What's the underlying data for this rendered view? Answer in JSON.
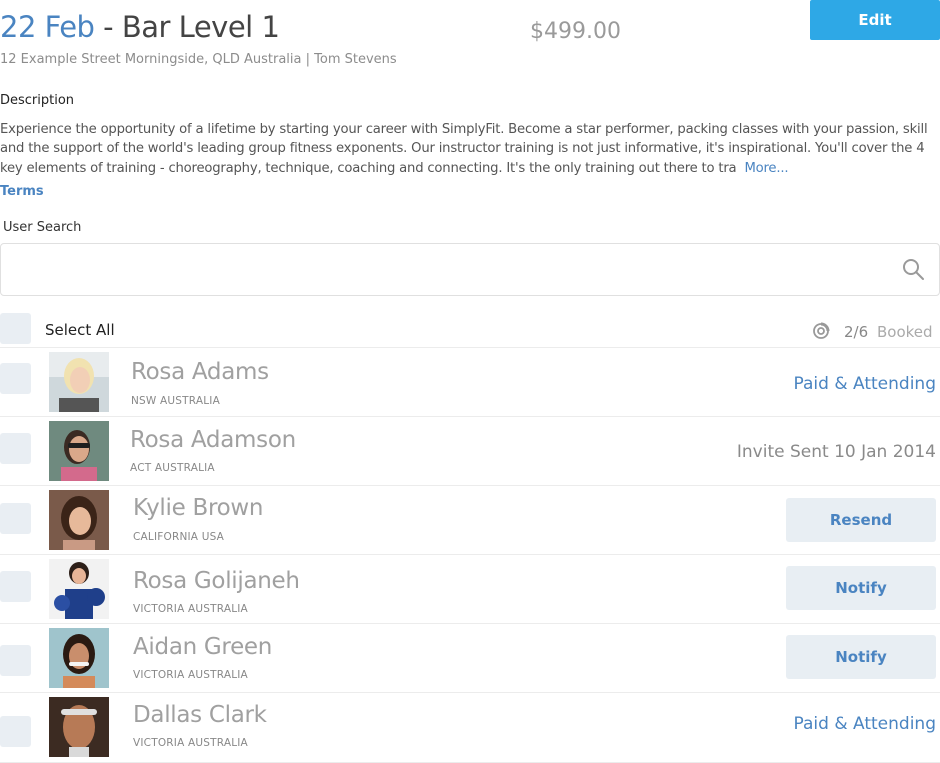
{
  "header": {
    "date": "22 Feb",
    "title_rest": " - Bar Level 1",
    "price": "$499.00",
    "edit_label": "Edit",
    "subtitle": "12 Example Street Morningside, QLD Australia | Tom Stevens"
  },
  "description": {
    "label": "Description",
    "text": "Experience the opportunity of a lifetime by starting your career with SimplyFit. Become a star performer, packing classes with your passion, skill and the support of the world's leading group fitness exponents.  Our instructor training is not just informative, it's inspirational. You'll cover the 4 key elements of training - choreography, technique, coaching and connecting. It's the only training out there to tra",
    "more_label": "More...",
    "terms_label": "Terms"
  },
  "search": {
    "label": "User Search",
    "value": "",
    "placeholder": ""
  },
  "list": {
    "select_all_label": "Select All",
    "booked_count": "2/6",
    "booked_label": "Booked",
    "users": [
      {
        "name": "Rosa Adams",
        "location": "NSW AUSTRALIA",
        "status": "Paid & Attending",
        "status_type": "paid"
      },
      {
        "name": "Rosa Adamson",
        "location": "ACT AUSTRALIA",
        "status": "Invite Sent 10 Jan 2014",
        "status_type": "invite"
      },
      {
        "name": "Kylie Brown",
        "location": "CALIFORNIA USA",
        "status": "Resend",
        "status_type": "button"
      },
      {
        "name": "Rosa Golijaneh",
        "location": "VICTORIA AUSTRALIA",
        "status": "Notify",
        "status_type": "button"
      },
      {
        "name": "Aidan Green",
        "location": "VICTORIA AUSTRALIA",
        "status": "Notify",
        "status_type": "button"
      },
      {
        "name": "Dallas Clark",
        "location": "VICTORIA AUSTRALIA",
        "status": "Paid & Attending",
        "status_type": "paid"
      }
    ]
  },
  "colors": {
    "accent": "#4a84c1",
    "edit_button": "#2ea8e6",
    "checkbox": "#e9eef3",
    "action_button_bg": "#e8eef3"
  }
}
